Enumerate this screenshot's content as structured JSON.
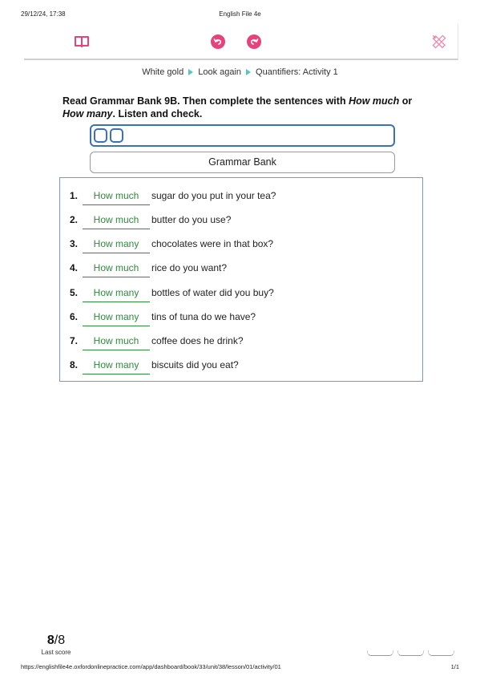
{
  "print_header": {
    "date": "29/12/24, 17:38",
    "title": "English File 4e"
  },
  "toolbar": {
    "icons": {
      "book": "book-icon",
      "undo": "undo-icon",
      "redo": "redo-icon",
      "tools": "pencil-ruler-icon"
    },
    "accent": "#e8427a"
  },
  "breadcrumb": [
    "White gold",
    "Look again",
    "Quantifiers: Activity 1"
  ],
  "instructions": {
    "part1": "Read Grammar Bank 9B. Then complete the sentences with ",
    "em1": "How much",
    "part2": " or ",
    "em2": "How many",
    "part3": ". Listen and check."
  },
  "grammar_bank_label": "Grammar Bank",
  "exercise": {
    "items": [
      {
        "num": "1.",
        "answer": "How much",
        "text": "sugar do you put in your tea?"
      },
      {
        "num": "2.",
        "answer": "How much",
        "text": "butter do you use?"
      },
      {
        "num": "3.",
        "answer": "How many",
        "text": "chocolates were in that box?"
      },
      {
        "num": "4.",
        "answer": "How much",
        "text": "rice do you want?"
      },
      {
        "num": "5.",
        "answer": "How many",
        "text": "bottles of water did you buy?"
      },
      {
        "num": "6.",
        "answer": "How many",
        "text": "tins of tuna do we have?"
      },
      {
        "num": "7.",
        "answer": "How much",
        "text": "coffee does he drink?"
      },
      {
        "num": "8.",
        "answer": "How many",
        "text": "biscuits did you eat?"
      }
    ],
    "answer_color": "#2e8b3a"
  },
  "score": {
    "value": "8",
    "total": "/8",
    "label": "Last score"
  },
  "print_footer": {
    "url": "https://englishfile4e.oxfordonlinepractice.com/app/dashboard/book/33/unit/38/lesson/01/activity/01",
    "page": "1/1"
  }
}
